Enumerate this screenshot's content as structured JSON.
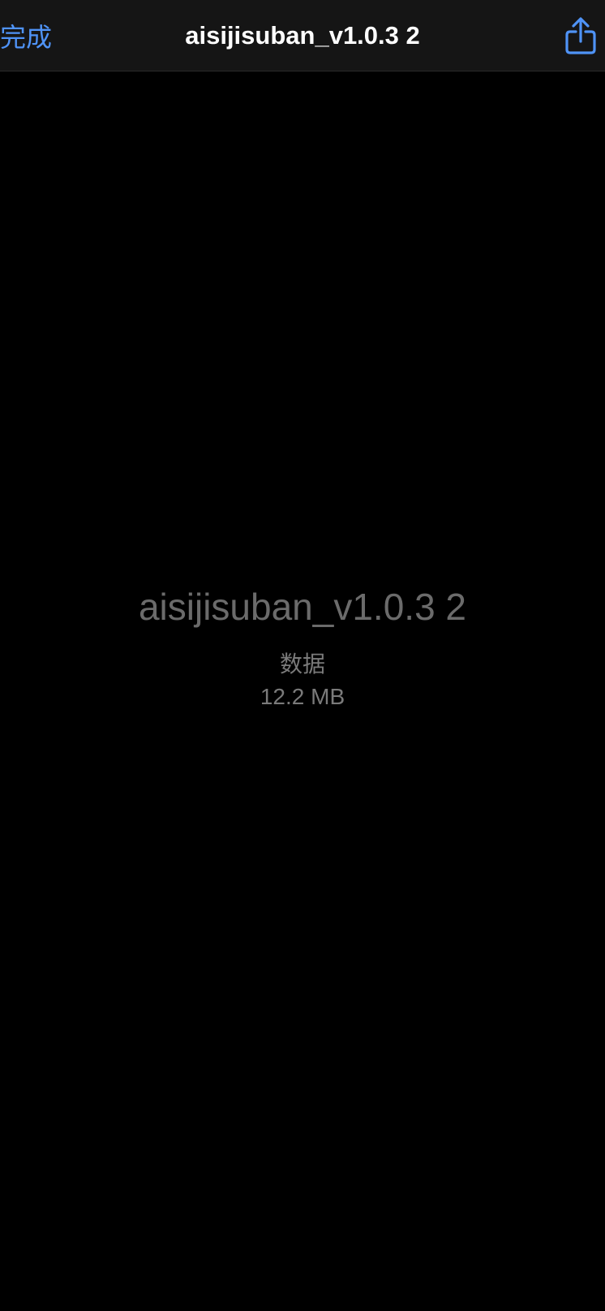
{
  "nav": {
    "done_label": "完成",
    "title": "aisijisuban_v1.0.3 2",
    "share_icon": "share-icon"
  },
  "file": {
    "name": "aisijisuban_v1.0.3 2",
    "type": "数据",
    "size": "12.2 MB"
  },
  "colors": {
    "background": "#000000",
    "nav_background": "#151515",
    "accent": "#4f93f6",
    "title": "#ffffff",
    "secondary_text": "#6b6b6b"
  }
}
